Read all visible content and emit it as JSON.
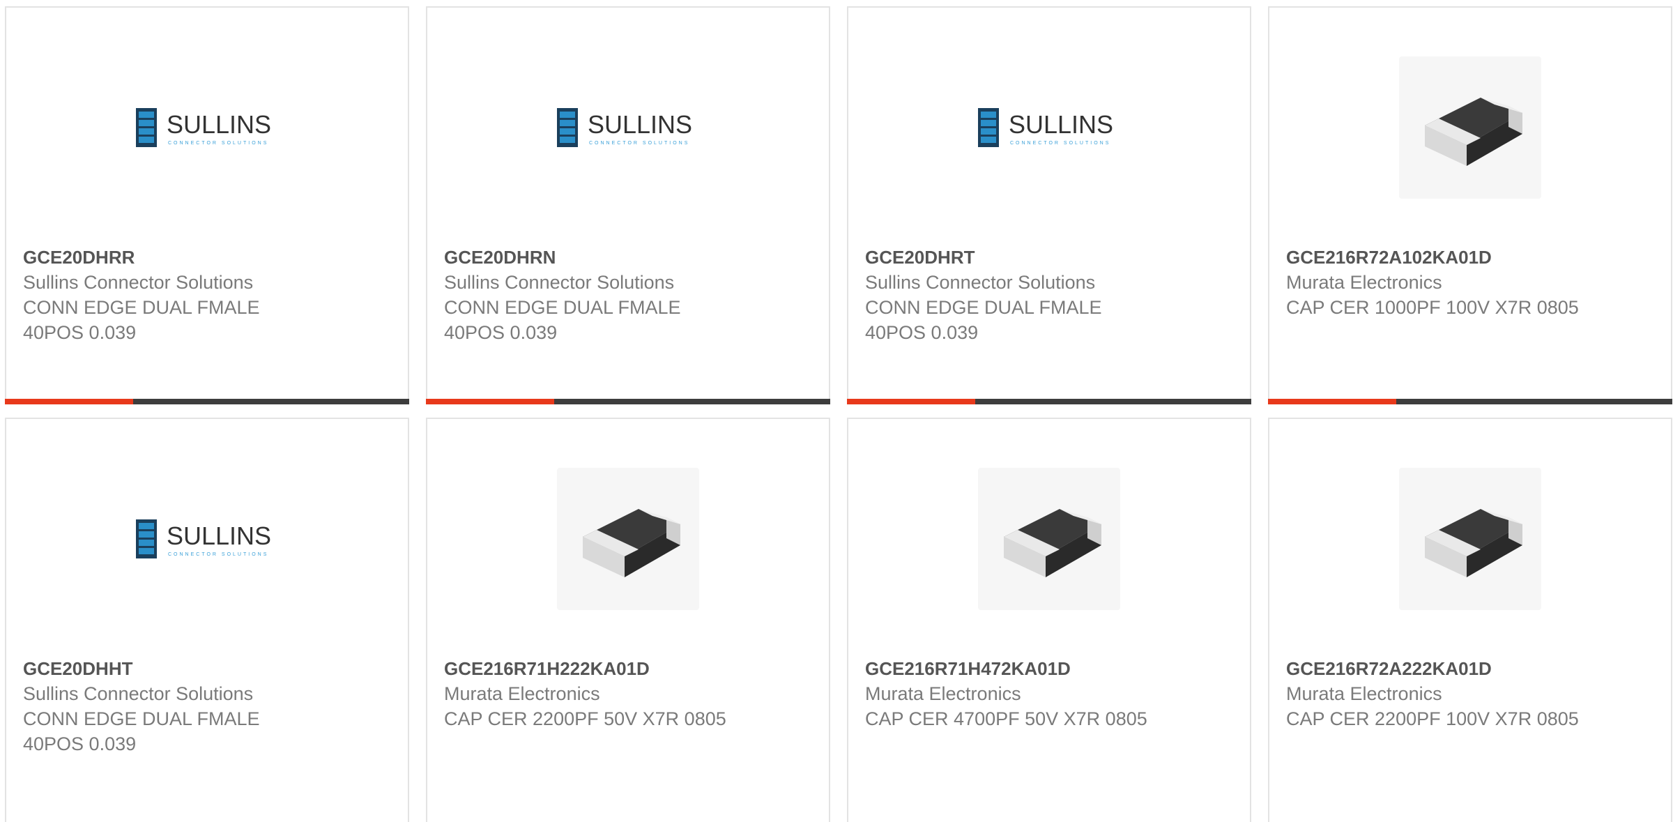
{
  "accent_color": "#e8391b",
  "bar_color": "#3d3d3d",
  "products": [
    {
      "part": "GCE20DHRR",
      "manufacturer": "Sullins Connector Solutions",
      "description": "CONN EDGE DUAL FMALE 40POS 0.039",
      "image": "sullins-logo",
      "logo_text": "SULLINS",
      "logo_sub": "CONNECTOR SOLUTIONS"
    },
    {
      "part": "GCE20DHRN",
      "manufacturer": "Sullins Connector Solutions",
      "description": "CONN EDGE DUAL FMALE 40POS 0.039",
      "image": "sullins-logo",
      "logo_text": "SULLINS",
      "logo_sub": "CONNECTOR SOLUTIONS"
    },
    {
      "part": "GCE20DHRT",
      "manufacturer": "Sullins Connector Solutions",
      "description": "CONN EDGE DUAL FMALE 40POS 0.039",
      "image": "sullins-logo",
      "logo_text": "SULLINS",
      "logo_sub": "CONNECTOR SOLUTIONS"
    },
    {
      "part": "GCE216R72A102KA01D",
      "manufacturer": "Murata Electronics",
      "description": "CAP CER 1000PF 100V X7R 0805",
      "image": "smd-capacitor-image"
    },
    {
      "part": "GCE20DHHT",
      "manufacturer": "Sullins Connector Solutions",
      "description": "CONN EDGE DUAL FMALE 40POS 0.039",
      "image": "sullins-logo",
      "logo_text": "SULLINS",
      "logo_sub": "CONNECTOR SOLUTIONS"
    },
    {
      "part": "GCE216R71H222KA01D",
      "manufacturer": "Murata Electronics",
      "description": "CAP CER 2200PF 50V X7R 0805",
      "image": "smd-capacitor-image"
    },
    {
      "part": "GCE216R71H472KA01D",
      "manufacturer": "Murata Electronics",
      "description": "CAP CER 4700PF 50V X7R 0805",
      "image": "smd-capacitor-image"
    },
    {
      "part": "GCE216R72A222KA01D",
      "manufacturer": "Murata Electronics",
      "description": "CAP CER 2200PF 100V X7R 0805",
      "image": "smd-capacitor-image"
    }
  ]
}
